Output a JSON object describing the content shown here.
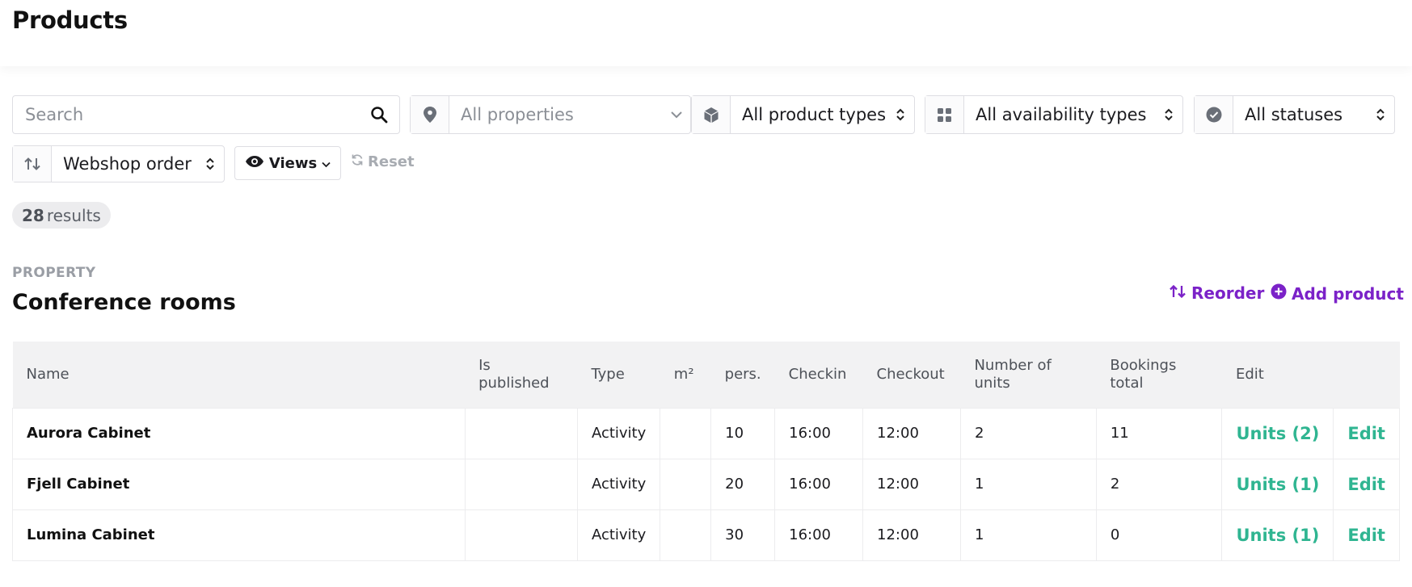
{
  "page": {
    "title": "Products"
  },
  "filters": {
    "search_placeholder": "Search",
    "properties": "All properties",
    "product_types": "All product types",
    "availability_types": "All availability types",
    "statuses": "All statuses",
    "order": "Webshop order",
    "views_label": "Views",
    "reset_label": "Reset"
  },
  "results": {
    "count": "28",
    "label": "results"
  },
  "section": {
    "eyebrow": "PROPERTY",
    "title": "Conference rooms",
    "reorder_label": "Reorder",
    "add_label": "Add product"
  },
  "table": {
    "headers": {
      "name": "Name",
      "published_1": "Is",
      "published_2": "published",
      "type": "Type",
      "area": "m²",
      "pers": "pers.",
      "checkin": "Checkin",
      "checkout": "Checkout",
      "units_1": "Number of",
      "units_2": "units",
      "bookings_1": "Bookings",
      "bookings_2": "total",
      "edit": "Edit"
    },
    "rows": [
      {
        "name": "Aurora Cabinet",
        "published": "",
        "type": "Activity",
        "area": "",
        "pers": "10",
        "checkin": "16:00",
        "checkout": "12:00",
        "units": "2",
        "bookings": "11",
        "units_link": "Units (2)",
        "edit_link": "Edit"
      },
      {
        "name": "Fjell Cabinet",
        "published": "",
        "type": "Activity",
        "area": "",
        "pers": "20",
        "checkin": "16:00",
        "checkout": "12:00",
        "units": "1",
        "bookings": "2",
        "units_link": "Units (1)",
        "edit_link": "Edit"
      },
      {
        "name": "Lumina Cabinet",
        "published": "",
        "type": "Activity",
        "area": "",
        "pers": "30",
        "checkin": "16:00",
        "checkout": "12:00",
        "units": "1",
        "bookings": "0",
        "units_link": "Units (1)",
        "edit_link": "Edit"
      }
    ]
  },
  "colors": {
    "accent": "#7b22c8",
    "link": "#2fb591",
    "header_bg": "#f2f2f3"
  },
  "icons": [
    "search-icon",
    "map-pin-icon",
    "cube-icon",
    "grid-icon",
    "check-circle-icon",
    "sort-arrows-icon",
    "eye-icon",
    "reset-icon",
    "plus-circle-icon",
    "chevron-down-icon",
    "updown-caret-icon"
  ]
}
